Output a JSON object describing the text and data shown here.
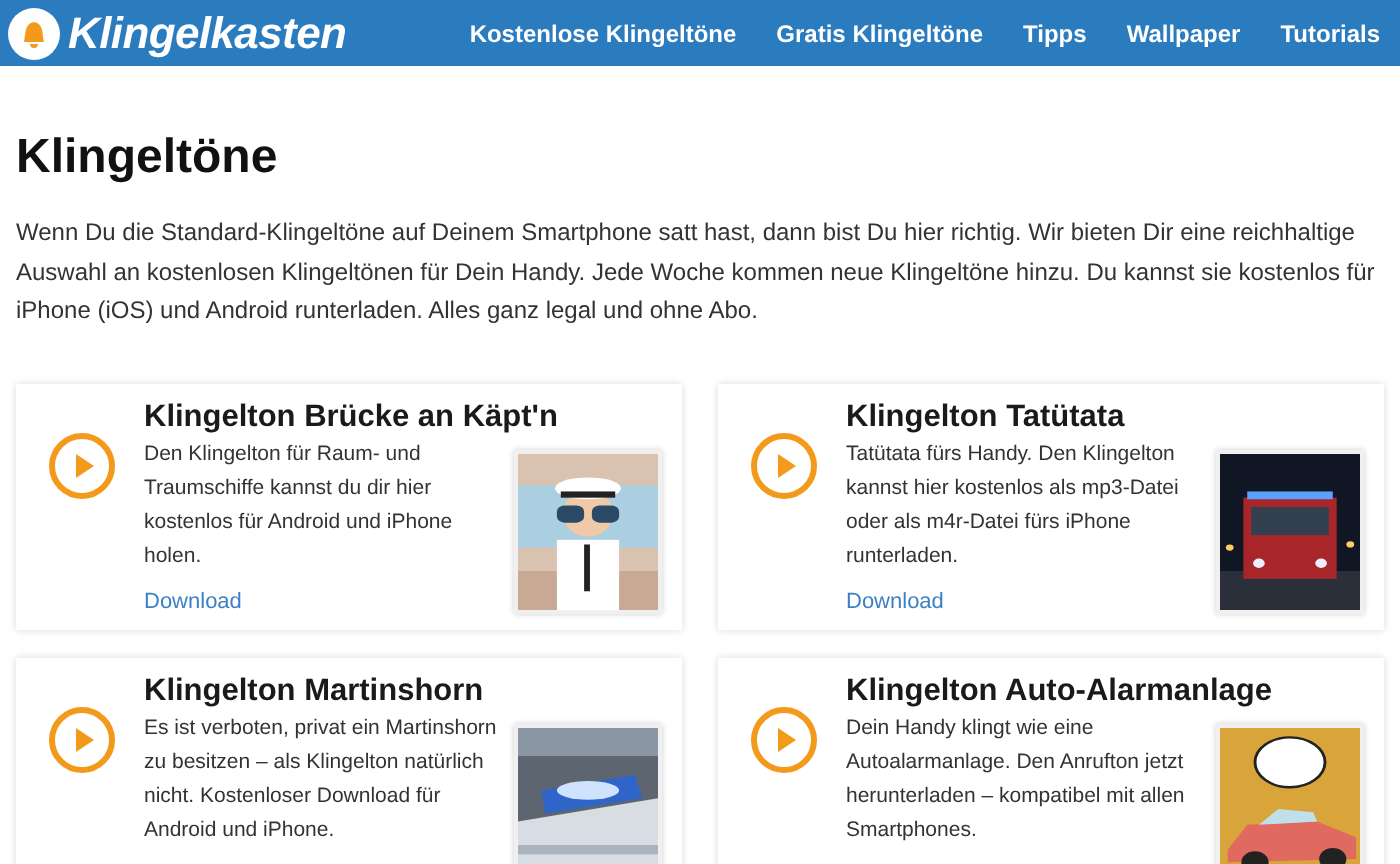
{
  "header": {
    "logo": "Klingelkasten",
    "nav": [
      "Kostenlose Klingeltöne",
      "Gratis Klingeltöne",
      "Tipps",
      "Wallpaper",
      "Tutorials"
    ]
  },
  "page": {
    "title": "Klingeltöne",
    "intro": "Wenn Du die Standard-Klingeltöne auf Deinem Smartphone satt hast, dann bist Du hier richtig. Wir bieten Dir eine reichhaltige Auswahl an kostenlosen Klingeltönen für Dein Handy. Jede Woche kommen neue Klingeltöne hinzu. Du kannst sie kostenlos für iPhone (iOS) und Android runterladen. Alles ganz legal und ohne Abo."
  },
  "cards": [
    {
      "title": "Klingelton Brücke an Käpt'n",
      "description": "Den Klingelton für Raum- und Traumschiffe kannst du dir hier kostenlos für Android und iPhone holen.",
      "link": "Download"
    },
    {
      "title": "Klingelton Tatütata",
      "description": "Tatütata fürs Handy. Den Klingelton kannst hier kostenlos als mp3-Datei oder als m4r-Datei fürs iPhone runterladen.",
      "link": "Download"
    },
    {
      "title": "Klingelton Martinshorn",
      "description": "Es ist verboten, privat ein Martinshorn zu besitzen – als Klingelton natürlich nicht. Kostenloser Download für Android und iPhone."
    },
    {
      "title": "Klingelton Auto-Alarmanlage",
      "description": "Dein Handy klingt wie eine Autoalarmanlage. Den Anrufton jetzt herunterladen – kompatibel mit allen Smartphones."
    }
  ]
}
